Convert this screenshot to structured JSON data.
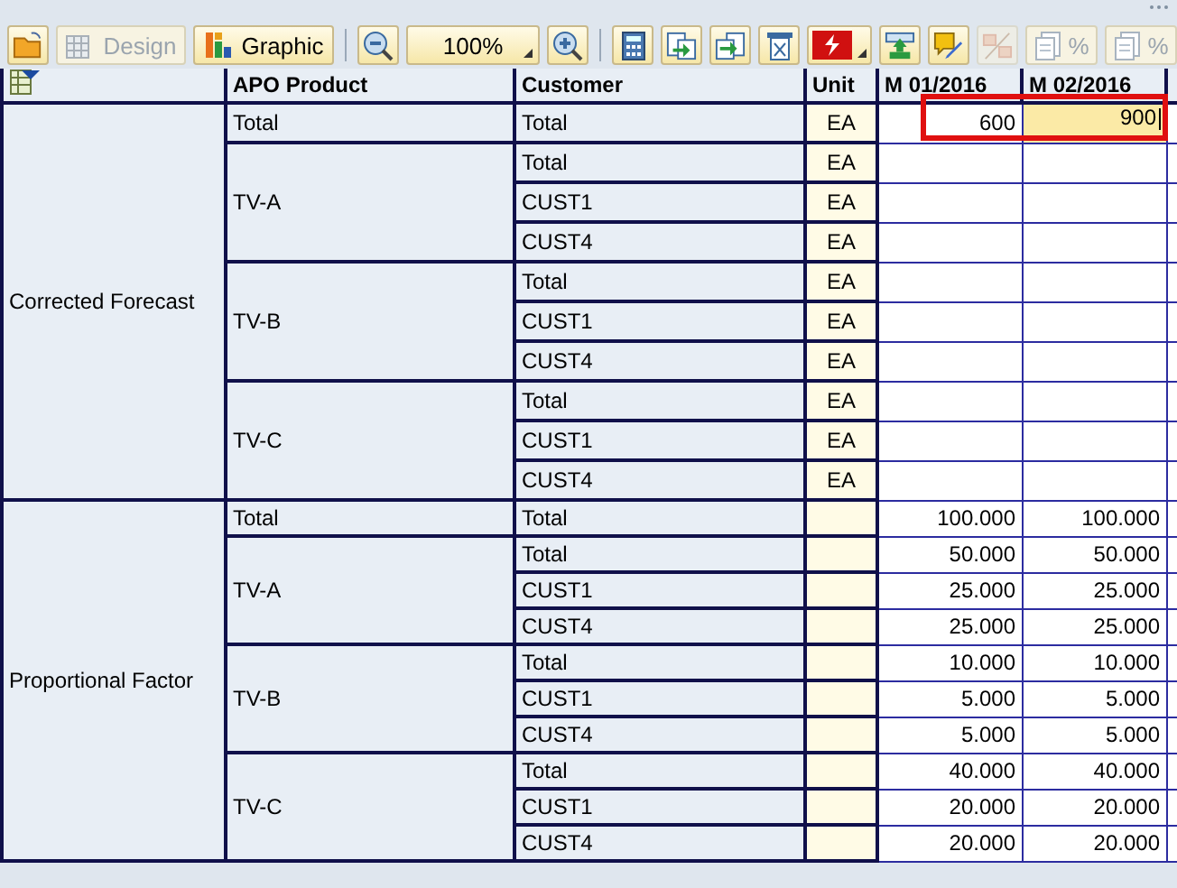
{
  "toolbar": [
    {
      "kind": "icon",
      "disabled": false
    },
    {
      "kind": "text",
      "label": "Design",
      "disabled": true
    },
    {
      "kind": "text",
      "label": "Graphic",
      "disabled": false
    },
    {
      "kind": "separator"
    },
    {
      "kind": "icon",
      "disabled": false
    },
    {
      "kind": "dropdown",
      "label": "100%",
      "disabled": false
    },
    {
      "kind": "icon",
      "disabled": false
    },
    {
      "kind": "separator"
    },
    {
      "kind": "icon",
      "disabled": false
    },
    {
      "kind": "icon",
      "disabled": false
    },
    {
      "kind": "icon",
      "disabled": false
    },
    {
      "kind": "icon",
      "disabled": false
    },
    {
      "kind": "icondrop",
      "disabled": false
    },
    {
      "kind": "icon",
      "disabled": false
    },
    {
      "kind": "icon",
      "disabled": false
    },
    {
      "kind": "icon",
      "disabled": true
    },
    {
      "kind": "text",
      "label": "%",
      "disabled": true
    },
    {
      "kind": "text",
      "label": "%",
      "disabled": true
    }
  ],
  "table": {
    "columns": [
      "APO Product",
      "Customer",
      "Unit",
      "M 01/2016",
      "M 02/2016"
    ],
    "sections": [
      {
        "name": "Corrected Forecast",
        "groups": [
          {
            "product": "Total",
            "rows": [
              {
                "customer": "Total",
                "unit": "EA",
                "m01": "600",
                "m02": "900",
                "highlighted": true,
                "editing": true
              }
            ]
          },
          {
            "product": "TV-A",
            "rows": [
              {
                "customer": "Total",
                "unit": "EA"
              },
              {
                "customer": "CUST1",
                "unit": "EA"
              },
              {
                "customer": "CUST4",
                "unit": "EA"
              }
            ]
          },
          {
            "product": "TV-B",
            "rows": [
              {
                "customer": "Total",
                "unit": "EA"
              },
              {
                "customer": "CUST1",
                "unit": "EA"
              },
              {
                "customer": "CUST4",
                "unit": "EA"
              }
            ]
          },
          {
            "product": "TV-C",
            "rows": [
              {
                "customer": "Total",
                "unit": "EA"
              },
              {
                "customer": "CUST1",
                "unit": "EA"
              },
              {
                "customer": "CUST4",
                "unit": "EA"
              }
            ]
          }
        ]
      },
      {
        "name": "Proportional Factor",
        "groups": [
          {
            "product": "Total",
            "rows": [
              {
                "customer": "Total",
                "m01": "100.000",
                "m02": "100.000"
              }
            ]
          },
          {
            "product": "TV-A",
            "rows": [
              {
                "customer": "Total",
                "m01": "50.000",
                "m02": "50.000"
              },
              {
                "customer": "CUST1",
                "m01": "25.000",
                "m02": "25.000"
              },
              {
                "customer": "CUST4",
                "m01": "25.000",
                "m02": "25.000"
              }
            ]
          },
          {
            "product": "TV-B",
            "rows": [
              {
                "customer": "Total",
                "m01": "10.000",
                "m02": "10.000"
              },
              {
                "customer": "CUST1",
                "m01": "5.000",
                "m02": "5.000"
              },
              {
                "customer": "CUST4",
                "m01": "5.000",
                "m02": "5.000"
              }
            ]
          },
          {
            "product": "TV-C",
            "rows": [
              {
                "customer": "Total",
                "m01": "40.000",
                "m02": "40.000"
              },
              {
                "customer": "CUST1",
                "m01": "20.000",
                "m02": "20.000"
              },
              {
                "customer": "CUST4",
                "m01": "20.000",
                "m02": "20.000"
              }
            ]
          }
        ]
      }
    ]
  }
}
